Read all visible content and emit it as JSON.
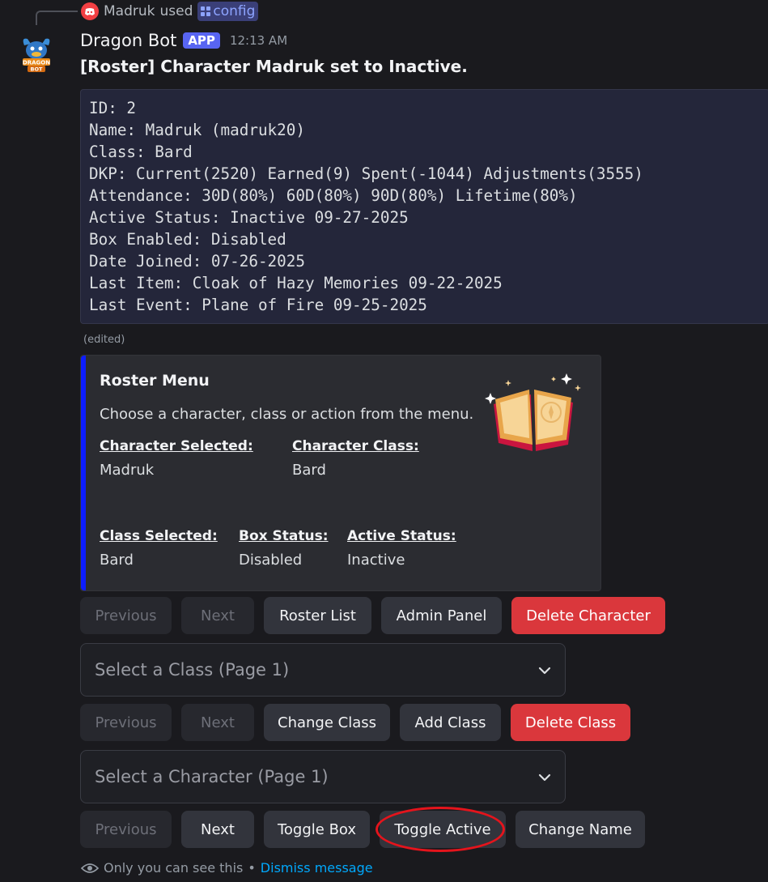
{
  "reply": {
    "user": "Madruk",
    "used_text": "used",
    "command": "config"
  },
  "header": {
    "bot_name": "Dragon Bot",
    "app_badge": "APP",
    "time": "12:13 AM"
  },
  "headline": "[Roster] Character Madruk set to Inactive.",
  "code_lines": [
    "ID: 2",
    "Name: Madruk (madruk20)",
    "Class: Bard",
    "DKP: Current(2520) Earned(9) Spent(-1044) Adjustments(3555)",
    "Attendance: 30D(80%) 60D(80%) 90D(80%) Lifetime(80%)",
    "Active Status: Inactive 09-27-2025",
    "Box Enabled: Disabled",
    "Date Joined: 07-26-2025",
    "Last Item: Cloak of Hazy Memories 09-22-2025",
    "Last Event: Plane of Fire 09-25-2025"
  ],
  "edited": "(edited)",
  "embed": {
    "title": "Roster Menu",
    "description": "Choose a character, class or action from the menu.",
    "accent_color": "#0d1dff",
    "fields": {
      "character_selected": {
        "name": "Character Selected:",
        "value": "Madruk"
      },
      "character_class": {
        "name": "Character Class:",
        "value": "Bard"
      },
      "class_selected": {
        "name": "Class Selected:",
        "value": "Bard"
      },
      "box_status": {
        "name": "Box Status:",
        "value": "Disabled"
      },
      "active_status": {
        "name": "Active Status:",
        "value": "Inactive"
      }
    }
  },
  "row1": {
    "previous": "Previous",
    "next": "Next",
    "roster_list": "Roster List",
    "admin_panel": "Admin Panel",
    "delete_character": "Delete Character"
  },
  "class_select": {
    "placeholder": "Select a Class (Page 1)"
  },
  "row2": {
    "previous": "Previous",
    "next": "Next",
    "change_class": "Change Class",
    "add_class": "Add Class",
    "delete_class": "Delete Class"
  },
  "character_select": {
    "placeholder": "Select a Character (Page 1)"
  },
  "row3": {
    "previous": "Previous",
    "next": "Next",
    "toggle_box": "Toggle Box",
    "toggle_active": "Toggle Active",
    "change_name": "Change Name"
  },
  "footer": {
    "text": "Only you can see this",
    "separator": "•",
    "dismiss": "Dismiss message"
  },
  "colors": {
    "danger": "#da373c",
    "brand": "#5865f2",
    "highlight_circle": "#e4141c",
    "link": "#00a8fc"
  }
}
